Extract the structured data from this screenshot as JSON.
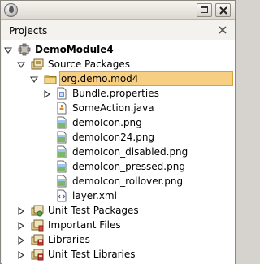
{
  "window": {
    "restore_button": "restore",
    "close_button": "close"
  },
  "panel": {
    "title": "Projects"
  },
  "tree": [
    {
      "label": "DemoModule4",
      "icon": "module-icon",
      "toggle": "expanded"
    },
    {
      "label": "Source Packages",
      "icon": "source-packages-icon",
      "toggle": "expanded"
    },
    {
      "label": "org.demo.mod4",
      "icon": "package-icon",
      "toggle": "expanded",
      "selected": true
    },
    {
      "label": "Bundle.properties",
      "icon": "properties-file-icon",
      "toggle": "collapsed"
    },
    {
      "label": "SomeAction.java",
      "icon": "java-file-icon",
      "toggle": "none"
    },
    {
      "label": "demoIcon.png",
      "icon": "image-file-icon",
      "toggle": "none"
    },
    {
      "label": "demoIcon24.png",
      "icon": "image-file-icon",
      "toggle": "none"
    },
    {
      "label": "demoIcon_disabled.png",
      "icon": "image-file-icon",
      "toggle": "none"
    },
    {
      "label": "demoIcon_pressed.png",
      "icon": "image-file-icon",
      "toggle": "none"
    },
    {
      "label": "demoIcon_rollover.png",
      "icon": "image-file-icon",
      "toggle": "none"
    },
    {
      "label": "layer.xml",
      "icon": "xml-file-icon",
      "toggle": "none"
    },
    {
      "label": "Unit Test Packages",
      "icon": "test-packages-icon",
      "toggle": "collapsed"
    },
    {
      "label": "Important Files",
      "icon": "important-files-icon",
      "toggle": "collapsed"
    },
    {
      "label": "Libraries",
      "icon": "libraries-icon",
      "toggle": "collapsed"
    },
    {
      "label": "Unit Test Libraries",
      "icon": "libraries-icon",
      "toggle": "collapsed"
    }
  ],
  "colors": {
    "selection": "#f6cf83",
    "selection_border": "#d8a03f",
    "panel_bg": "#f4f2ee"
  }
}
